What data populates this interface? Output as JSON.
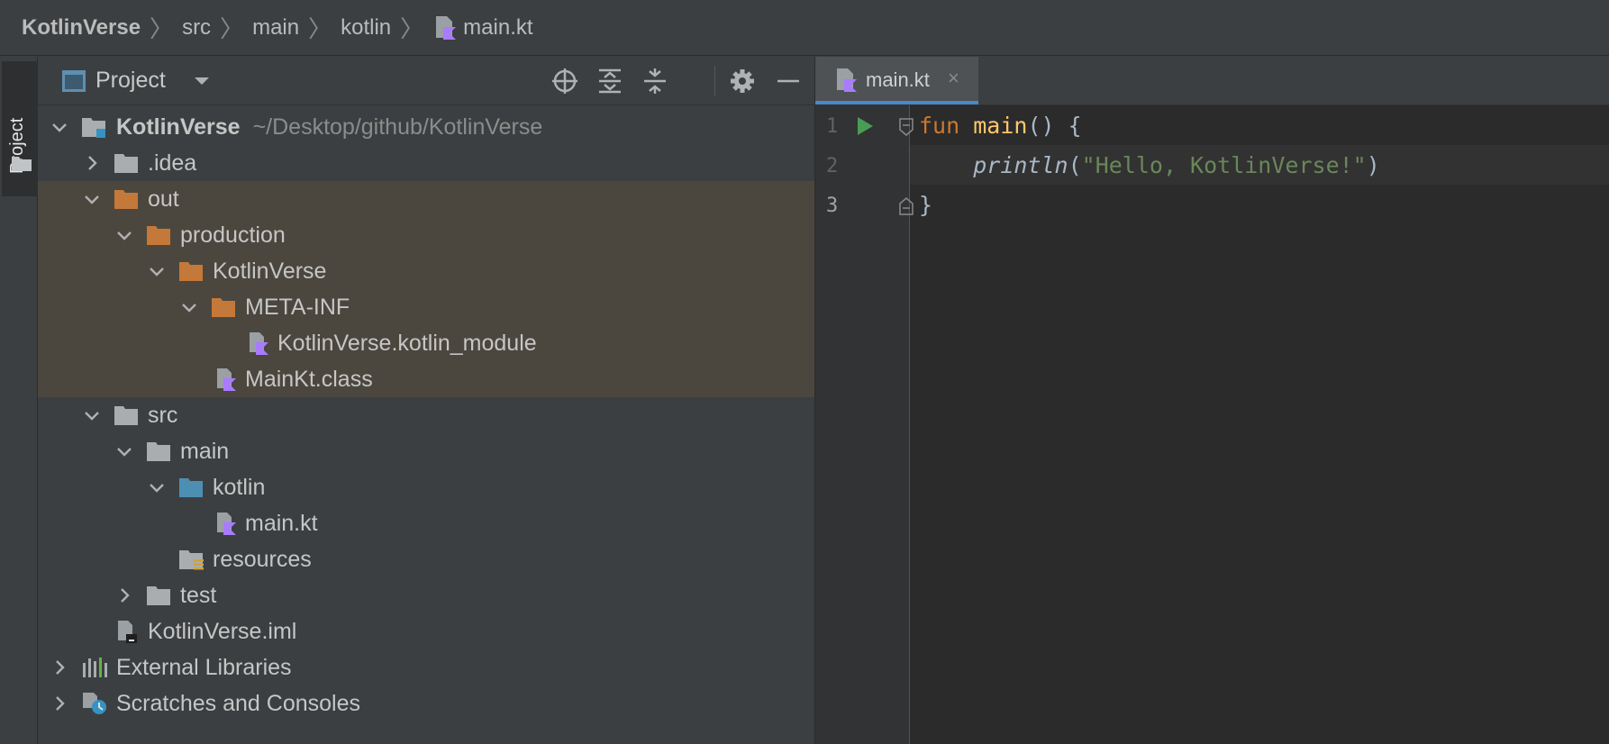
{
  "breadcrumb": {
    "items": [
      "KotlinVerse",
      "src",
      "main",
      "kotlin",
      "main.kt"
    ]
  },
  "toolstrip": {
    "project_label": "Project"
  },
  "project_panel": {
    "title": "Project",
    "tree": [
      {
        "label": "KotlinVerse",
        "extra": "~/Desktop/github/KotlinVerse"
      },
      {
        "label": ".idea"
      },
      {
        "label": "out"
      },
      {
        "label": "production"
      },
      {
        "label": "KotlinVerse"
      },
      {
        "label": "META-INF"
      },
      {
        "label": "KotlinVerse.kotlin_module"
      },
      {
        "label": "MainKt.class"
      },
      {
        "label": "src"
      },
      {
        "label": "main"
      },
      {
        "label": "kotlin"
      },
      {
        "label": "main.kt"
      },
      {
        "label": "resources"
      },
      {
        "label": "test"
      },
      {
        "label": "KotlinVerse.iml"
      },
      {
        "label": "External Libraries"
      },
      {
        "label": "Scratches and Consoles"
      }
    ]
  },
  "editor": {
    "tab_label": "main.kt",
    "tab_close": "×",
    "line_numbers": [
      "1",
      "2",
      "3"
    ],
    "code": {
      "l1_kw": "fun",
      "l1_fn": "main",
      "l1_rest": "() {",
      "l2_indent": "    ",
      "l2_fn": "println",
      "l2_open": "(",
      "l2_str": "\"Hello, KotlinVerse!\"",
      "l2_close": ")",
      "l3": "}"
    }
  },
  "colors": {
    "folder_orange": "#c47839",
    "folder_gray": "#a9adb0",
    "folder_blue": "#4d8fb3",
    "kotlin_purple": "#a97bff",
    "run_green": "#499c54",
    "tab_underline": "#4a88c7"
  }
}
